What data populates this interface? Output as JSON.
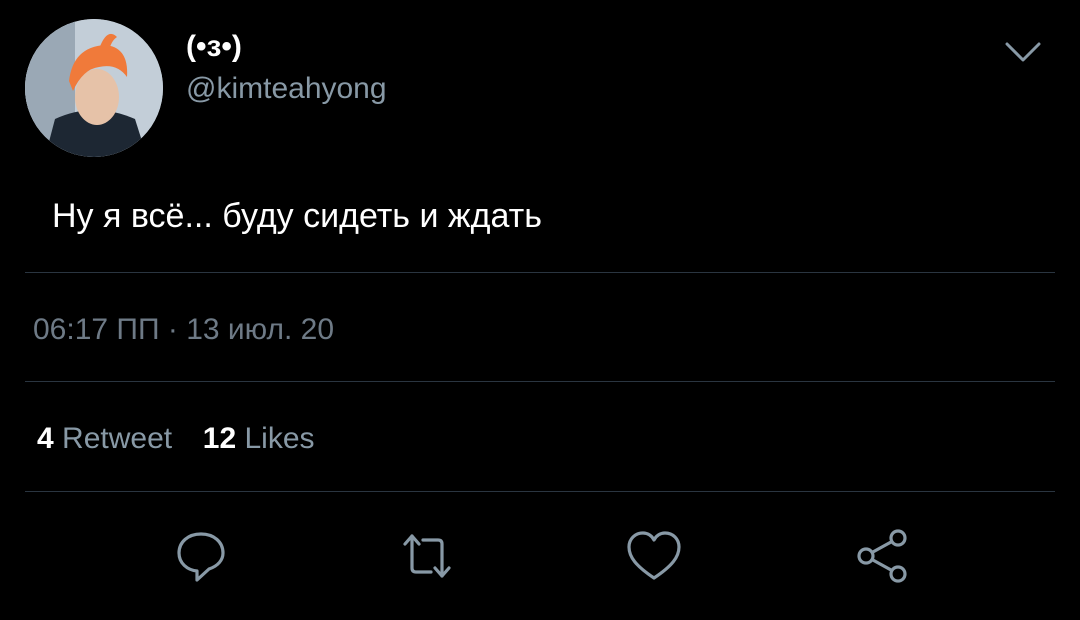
{
  "tweet": {
    "display_name": "(•з•)",
    "handle": "@kimteahyong",
    "text": "Ну я всё... буду сидеть и ждать",
    "timestamp": "06:17 ПП · 13 июл. 20"
  },
  "stats": {
    "retweets_count": "4",
    "retweets_label": "Retweet",
    "likes_count": "12",
    "likes_label": "Likes"
  },
  "icons": {
    "menu": "chevron-down-icon",
    "reply": "reply-icon",
    "retweet": "retweet-icon",
    "like": "heart-icon",
    "share": "share-icon"
  },
  "colors": {
    "background": "#000000",
    "primary_text": "#ffffff",
    "secondary_text": "#8899a6",
    "icon": "#8899a6",
    "divider": "#2a3540"
  }
}
